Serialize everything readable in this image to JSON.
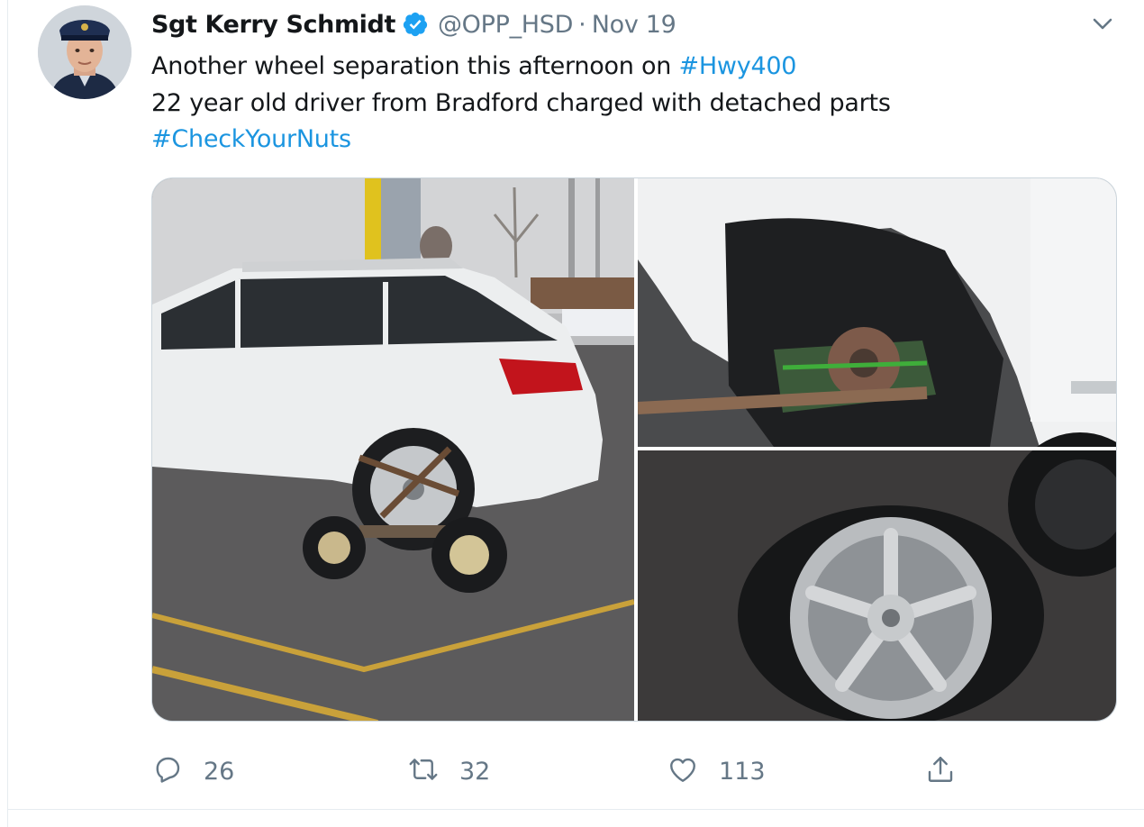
{
  "tweet": {
    "author_name": "Sgt Kerry Schmidt",
    "handle": "@OPP_HSD",
    "separator": "·",
    "date": "Nov 19",
    "verified": true,
    "text_line1_prefix": "Another wheel separation this afternoon on ",
    "text_line1_hashtag": "#Hwy400",
    "text_line2": "22 year old driver from Bradford charged with detached parts",
    "text_line3_hashtag": "#CheckYourNuts"
  },
  "actions": {
    "replies": "26",
    "retweets": "32",
    "likes": "113"
  },
  "icons": {
    "verified": "verified-badge-icon",
    "caret": "chevron-down-icon",
    "reply": "reply-icon",
    "retweet": "retweet-icon",
    "like": "heart-icon",
    "share": "share-icon"
  },
  "colors": {
    "hashtag": "#1b95e0",
    "verified": "#1da1f2",
    "secondary_text": "#657786",
    "border": "#e6ecf0"
  }
}
